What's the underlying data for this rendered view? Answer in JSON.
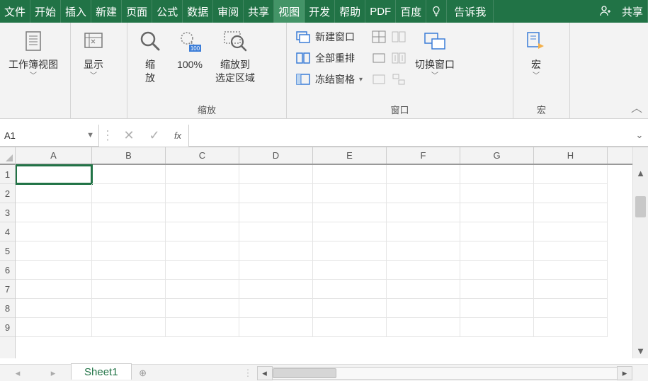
{
  "menu": {
    "file": "文件",
    "home": "开始",
    "insert": "插入",
    "new": "新建",
    "page": "页面",
    "formula": "公式",
    "data": "数据",
    "review": "审阅",
    "share": "共享",
    "view": "视图",
    "dev": "开发",
    "help": "帮助",
    "pdf": "PDF",
    "baidu": "百度",
    "tellme": "告诉我",
    "shareBtn": "共享"
  },
  "ribbon": {
    "group1": {
      "label": "",
      "btn": "工作簿视图",
      "caret": "﹀"
    },
    "group2": {
      "btn": "显示",
      "caret": "﹀"
    },
    "groupZoom": {
      "label": "缩放",
      "zoom": "缩\n放",
      "hundred": "100%",
      "toSel": "缩放到\n选定区域"
    },
    "groupWindow": {
      "label": "窗口",
      "newWin": "新建窗口",
      "arrange": "全部重排",
      "freeze": "冻结窗格",
      "switch": "切换窗口",
      "caret": "﹀"
    },
    "groupMacro": {
      "label": "宏",
      "btn": "宏",
      "caret": "﹀"
    }
  },
  "formula": {
    "nameBox": "A1",
    "fx": "fx"
  },
  "grid": {
    "cols": [
      "A",
      "B",
      "C",
      "D",
      "E",
      "F",
      "G",
      "H"
    ],
    "rows": [
      "1",
      "2",
      "3",
      "4",
      "5",
      "6",
      "7",
      "8",
      "9"
    ]
  },
  "sheet": {
    "tab": "Sheet1"
  }
}
